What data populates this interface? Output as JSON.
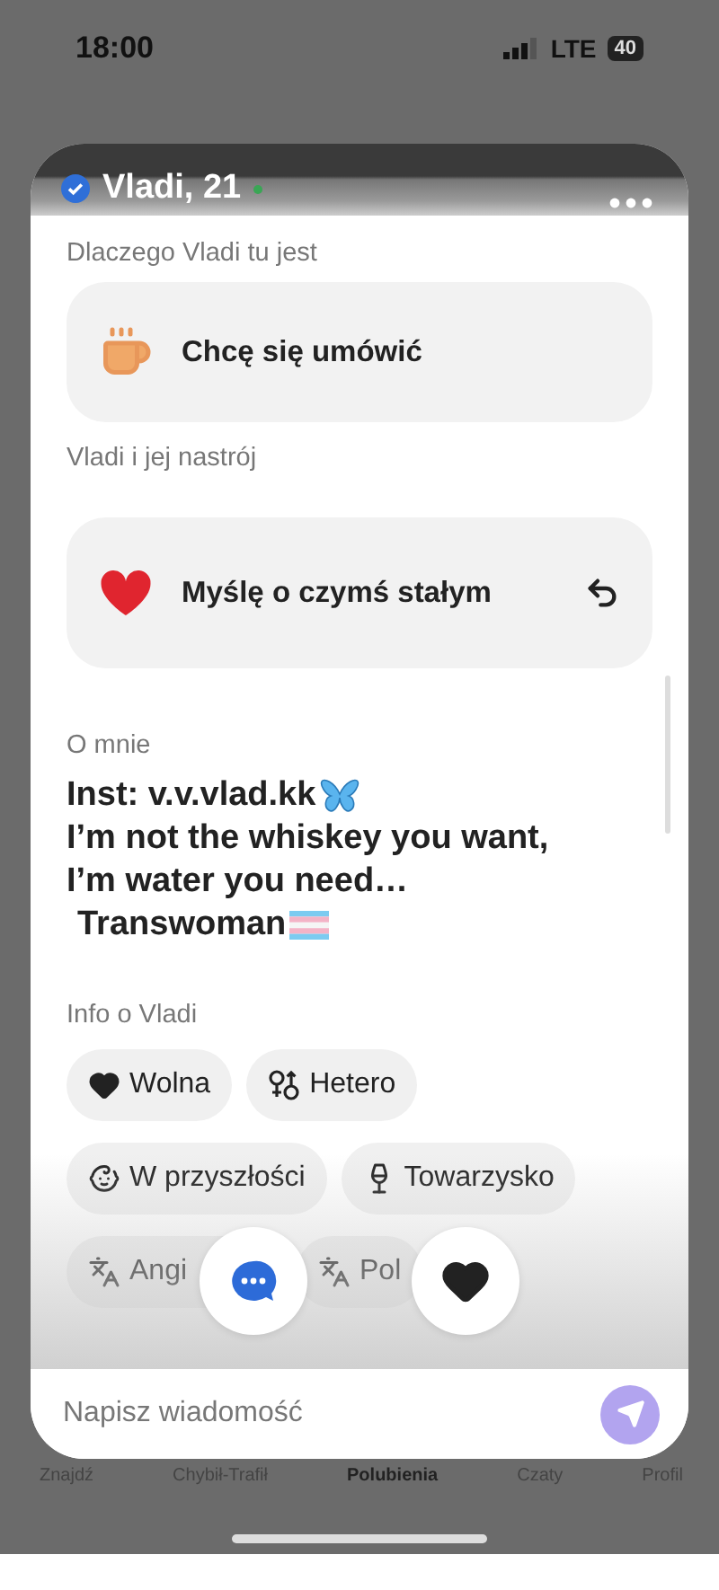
{
  "status_bar": {
    "time": "18:00",
    "network": "LTE",
    "battery": "40"
  },
  "profile": {
    "name": "Vladi, 21",
    "verified": true,
    "online": true
  },
  "sections": [
    {
      "kind": "reason",
      "label": "Dlaczego Vladi tu jest",
      "value": "Chcę się umówić"
    },
    {
      "kind": "mood",
      "label": "Vladi i jej nastrój",
      "value": "Myślę o czymś stałym"
    }
  ],
  "about": {
    "label": "O mnie",
    "lines": [
      {
        "text": "Inst: v.v.vlad.kk",
        "kind": "butterfly"
      },
      {
        "text": "I’m not the whiskey you want,"
      },
      {
        "text": "I’m water you need…"
      },
      {
        "text": "Transwoman",
        "kind": "flag"
      }
    ]
  },
  "info": {
    "label": "Info o Vladi",
    "rows": [
      [
        {
          "kind": "relationship",
          "text": "Wolna"
        },
        {
          "kind": "orientation",
          "text": "Hetero"
        }
      ],
      [
        {
          "kind": "children",
          "text": "W przyszłości"
        },
        {
          "kind": "drinking",
          "text": "Towarzysko"
        }
      ],
      [
        {
          "kind": "language",
          "text": "Angi"
        },
        {
          "kind": "language",
          "text": "Pol"
        }
      ]
    ]
  },
  "message": {
    "placeholder": "Napisz wiadomość"
  },
  "tabs": [
    {
      "label": "Znajdź",
      "selected": false
    },
    {
      "label": "Chybił-Trafił",
      "selected": false
    },
    {
      "label": "Polubienia",
      "selected": true
    },
    {
      "label": "Czaty",
      "selected": false
    },
    {
      "label": "Profil",
      "selected": false
    }
  ]
}
